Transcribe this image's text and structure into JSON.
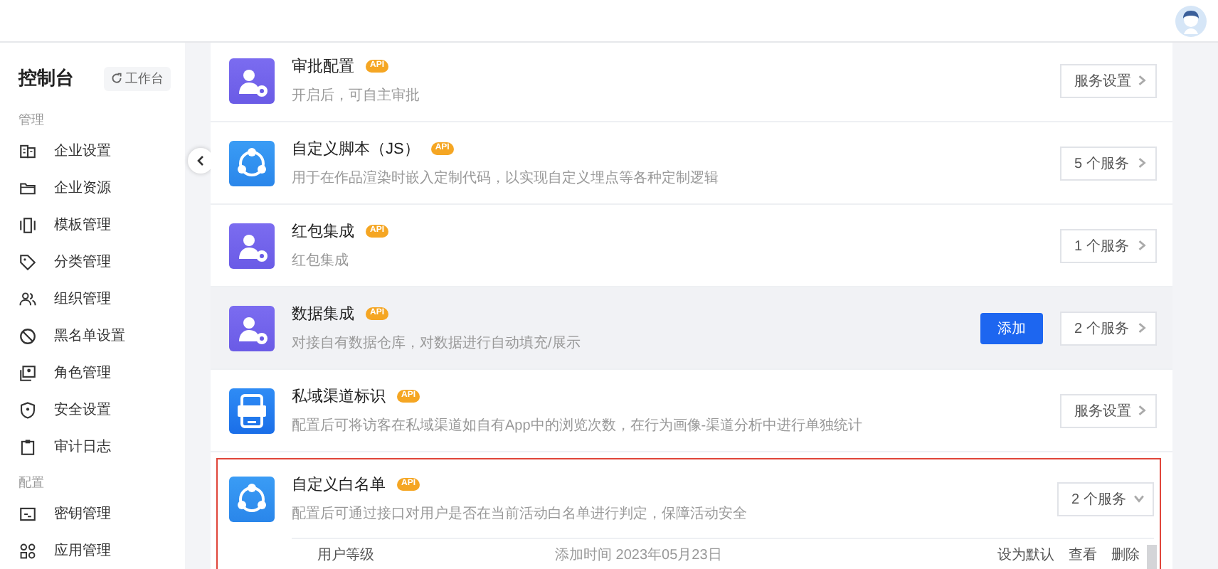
{
  "sidebar": {
    "title": "控制台",
    "workbench_button": "工作台",
    "sections": [
      {
        "label": "管理",
        "items": [
          {
            "label": "企业设置",
            "selected": false
          },
          {
            "label": "企业资源",
            "selected": false
          },
          {
            "label": "模板管理",
            "selected": false
          },
          {
            "label": "分类管理",
            "selected": false
          },
          {
            "label": "组织管理",
            "selected": false
          },
          {
            "label": "黑名单设置",
            "selected": false
          },
          {
            "label": "角色管理",
            "selected": false
          },
          {
            "label": "安全设置",
            "selected": false
          },
          {
            "label": "审计日志",
            "selected": false
          }
        ]
      },
      {
        "label": "配置",
        "items": [
          {
            "label": "密钥管理",
            "selected": false
          },
          {
            "label": "应用管理",
            "selected": false
          }
        ]
      }
    ]
  },
  "services": [
    {
      "title": "审批配置",
      "badge": "API",
      "description": "开启后，可自主审批",
      "button": "服务设置",
      "expanded": false,
      "hovered": false,
      "selected": false
    },
    {
      "title": "自定义脚本（JS）",
      "badge": "API",
      "description": "用于在作品渲染时嵌入定制代码，以实现自定义埋点等各种定制逻辑",
      "button": "5 个服务",
      "expanded": false,
      "hovered": false,
      "selected": false
    },
    {
      "title": "红包集成",
      "badge": "API",
      "description": "红包集成",
      "button": "1 个服务",
      "expanded": false,
      "hovered": false,
      "selected": false
    },
    {
      "title": "数据集成",
      "badge": "API",
      "description": "对接自有数据仓库，对数据进行自动填充/展示",
      "button": "2 个服务",
      "action": "添加",
      "expanded": false,
      "hovered": true,
      "selected": false
    },
    {
      "title": "私域渠道标识",
      "badge": "API",
      "description": "配置后可将访客在私域渠道如自有App中的浏览次数，在行为画像-渠道分析中进行单独统计",
      "button": "服务设置",
      "expanded": false,
      "hovered": false,
      "selected": false
    },
    {
      "title": "自定义白名单",
      "badge": "API",
      "description": "配置后可通过接口对用户是否在当前活动白名单进行判定，保障活动安全",
      "button": "2 个服务",
      "expanded": true,
      "hovered": false,
      "selected": true,
      "sub_rows": [
        {
          "name": "用户等级",
          "added": "添加时间 2023年05月23日",
          "actions": [
            "设为默认",
            "查看",
            "删除"
          ]
        }
      ]
    }
  ]
}
